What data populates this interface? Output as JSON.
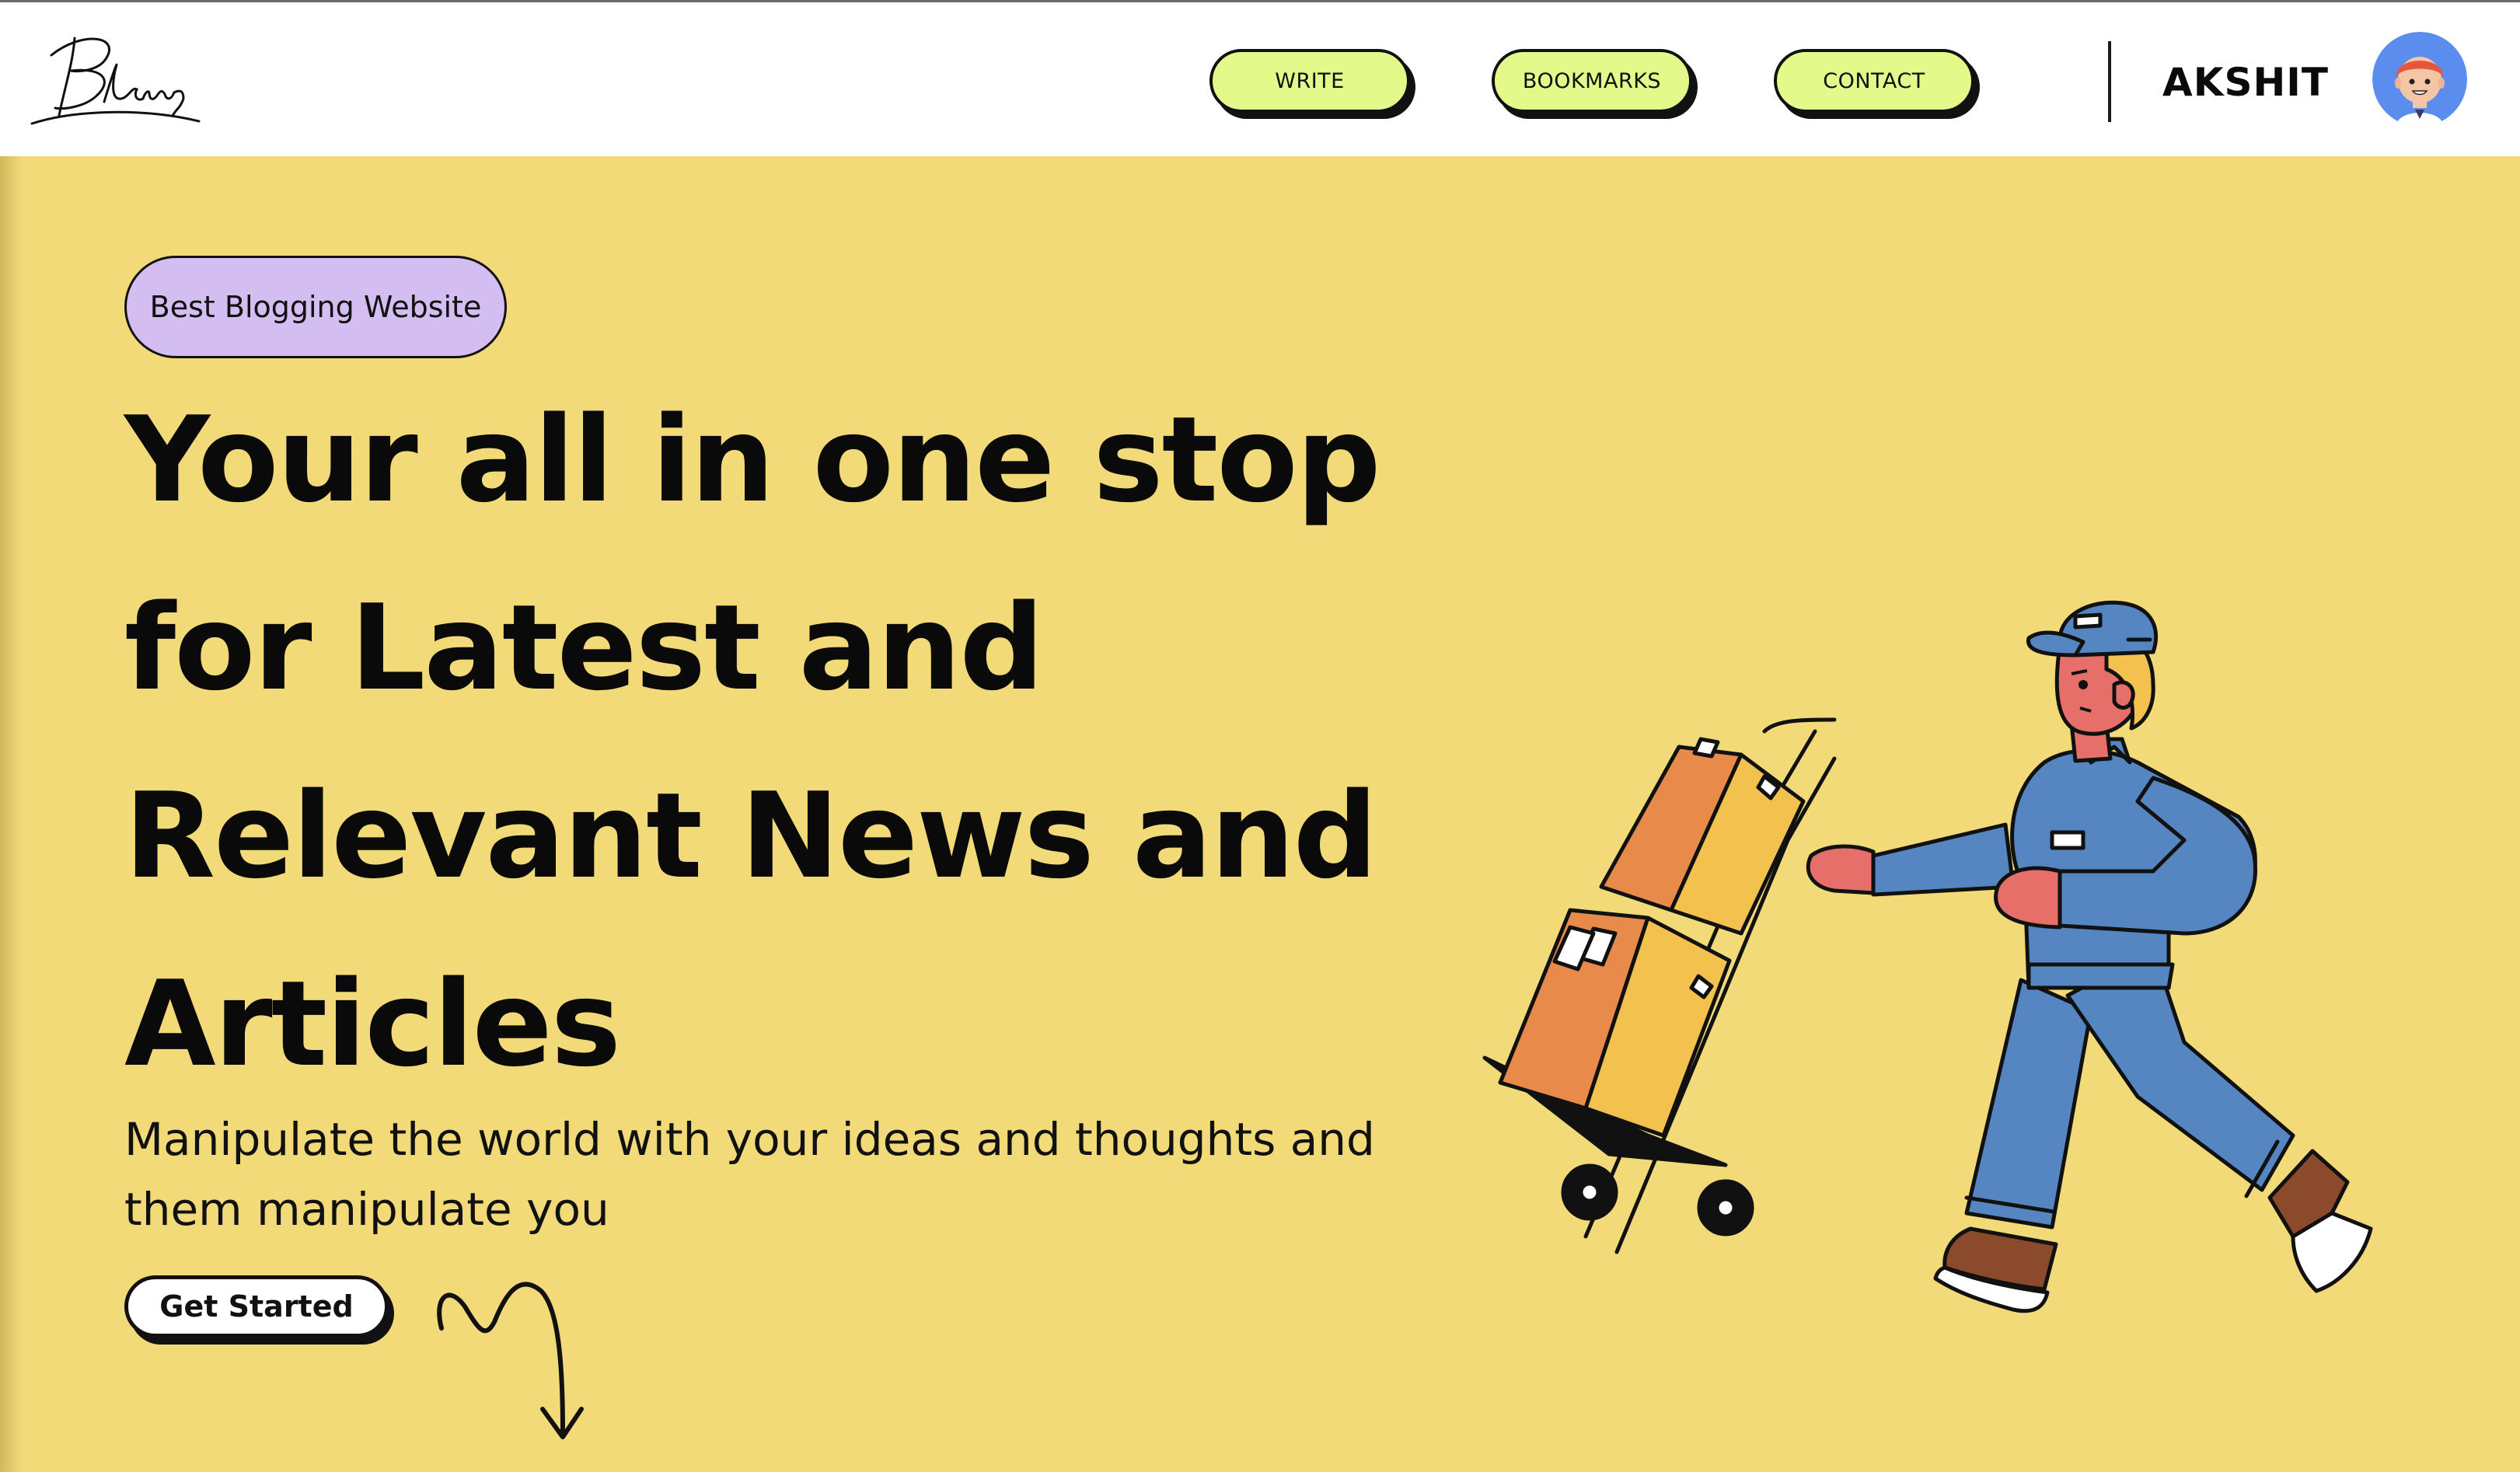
{
  "nav": {
    "logo_text": "Blawg",
    "links": [
      {
        "label": "WRITE"
      },
      {
        "label": "BOOKMARKS"
      },
      {
        "label": "CONTACT"
      }
    ],
    "user_name": "AKSHIT"
  },
  "hero": {
    "badge": "Best Blogging Website",
    "headline_lines": [
      "Your all in one stop",
      "for Latest and",
      "Relevant News and",
      "Articles"
    ],
    "subtext_lines": [
      "Manipulate the world with your ideas and thoughts and",
      "them manipulate you"
    ],
    "cta_label": "Get Started"
  },
  "colors": {
    "hero_bg": "#f3da78",
    "nav_button_bg": "#e3f98a",
    "badge_bg": "#d4bdf0",
    "avatar_bg": "#5b8def"
  },
  "icons": {
    "logo": "blawg-script-logo",
    "avatar": "user-avatar",
    "arrow": "squiggle-down-arrow",
    "illustration": "delivery-man-with-hand-truck"
  }
}
